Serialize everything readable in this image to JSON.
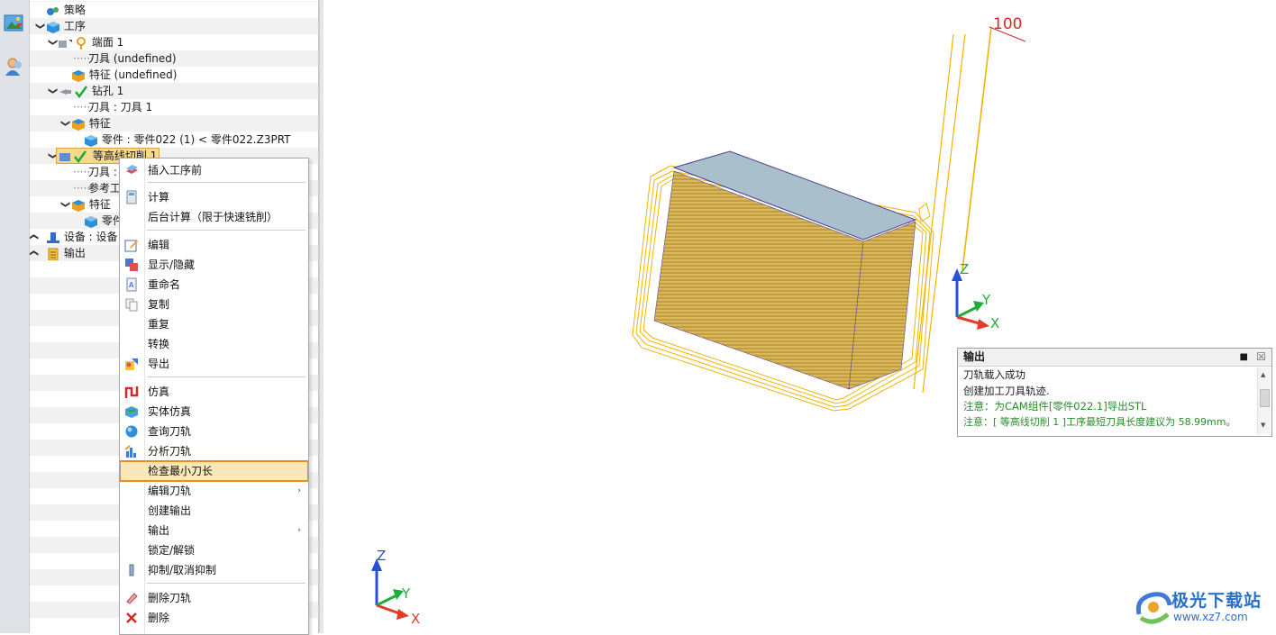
{
  "tree": {
    "rows": [
      {
        "label": "策略"
      },
      {
        "label": "工序"
      },
      {
        "label": "端面 1"
      },
      {
        "label": "刀具 (undefined)"
      },
      {
        "label": "特征 (undefined)"
      },
      {
        "label": "钻孔 1"
      },
      {
        "label": "刀具 : 刀具 1"
      },
      {
        "label": "特征"
      },
      {
        "label": "零件 : 零件022 (1) < 零件022.Z3PRT"
      },
      {
        "label": "等高线切削 1"
      },
      {
        "label": "刀具 :"
      },
      {
        "label": "参考工"
      },
      {
        "label": "特征"
      },
      {
        "label": "零件"
      },
      {
        "label": "设备 : 设备 1"
      },
      {
        "label": "输出"
      }
    ]
  },
  "context_menu": {
    "items": [
      {
        "label": "插入工序前"
      },
      {
        "label": "计算"
      },
      {
        "label": "后台计算（限于快速铣削）"
      },
      {
        "label": "编辑"
      },
      {
        "label": "显示/隐藏"
      },
      {
        "label": "重命名"
      },
      {
        "label": "复制"
      },
      {
        "label": "重复"
      },
      {
        "label": "转换"
      },
      {
        "label": "导出"
      },
      {
        "label": "仿真"
      },
      {
        "label": "实体仿真"
      },
      {
        "label": "查询刀轨"
      },
      {
        "label": "分析刀轨"
      },
      {
        "label": "检查最小刀长"
      },
      {
        "label": "编辑刀轨"
      },
      {
        "label": "创建输出"
      },
      {
        "label": "输出"
      },
      {
        "label": "锁定/解锁"
      },
      {
        "label": "抑制/取消抑制"
      },
      {
        "label": "删除刀轨"
      },
      {
        "label": "删除"
      }
    ],
    "submenu_arrow": "›"
  },
  "viewport": {
    "dimension_label": "100",
    "axis": {
      "x": "X",
      "y": "Y",
      "z": "Z"
    }
  },
  "output_panel": {
    "title": "输出",
    "pin_glyph": "■",
    "close_glyph": "☒",
    "lines": [
      {
        "text": "刀轨载入成功",
        "color": "#1a1a1a"
      },
      {
        "text": "创建加工刀具轨迹.",
        "color": "#1a1a1a"
      },
      {
        "text": "注意：为CAM组件[零件022.1]导出STL",
        "color": "#2a8a2a"
      },
      {
        "text": "注意：[ 等高线切削 1 ]工序最短刀具长度建议为 58.99mm。",
        "color": "#2a8a2a"
      }
    ]
  },
  "watermark": {
    "name": "极光下载站",
    "url": "www.xz7.com"
  },
  "colors": {
    "toolpath": "#f0b400",
    "block_top": "#a9bfcc",
    "highlight_border": "#f08a1e",
    "axis_x": "#e23b2a",
    "axis_y": "#1fae3a",
    "axis_z": "#2a4fd8"
  }
}
